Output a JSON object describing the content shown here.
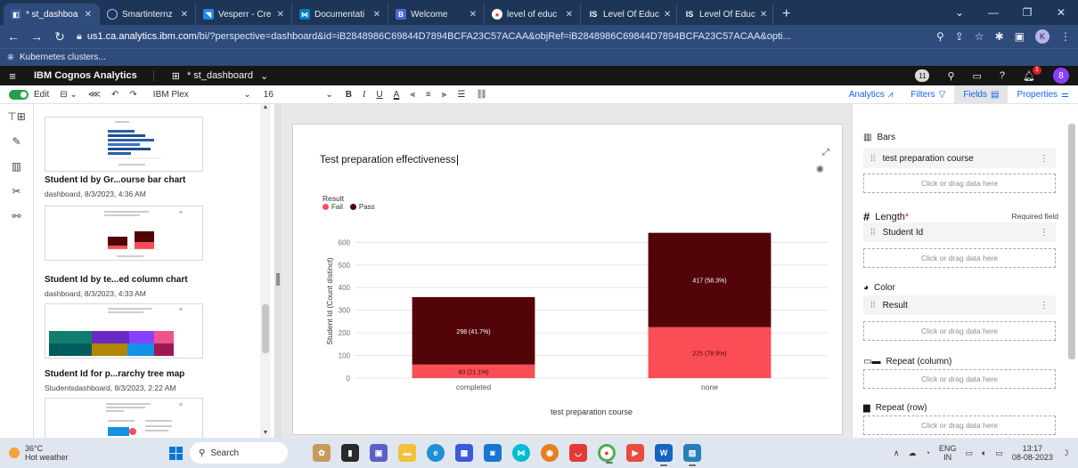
{
  "browser": {
    "tabs": [
      {
        "title": "* st_dashboa",
        "icon": "ibm-icon",
        "active": true
      },
      {
        "title": "Smartinternz",
        "icon": "smartinternz-icon"
      },
      {
        "title": "Vesperr - Cre",
        "icon": "vesperr-icon"
      },
      {
        "title": "Documentati",
        "icon": "vscode-icon"
      },
      {
        "title": "Welcome",
        "icon": "b-icon"
      },
      {
        "title": "level of educ",
        "icon": "chrome-icon"
      },
      {
        "title": "Level Of Educ",
        "icon": "is-icon"
      },
      {
        "title": "Level Of Educ",
        "icon": "is-icon"
      }
    ],
    "url_host": "us1.ca.analytics.ibm.com",
    "url_path": "/bi/?perspective=dashboard&id=iB2848986C69844D7894BCFA23C57ACAA&objRef=iB2848986C69844D7894BCFA23C57ACAA&opti...",
    "profile_initial": "K",
    "bookmark": "Kubernetes clusters..."
  },
  "app": {
    "brand": "IBM Cognos Analytics",
    "dashboard_name": "* st_dashboard",
    "badge_count": "11",
    "notif_count": "1",
    "user_initial": "8"
  },
  "toolbar": {
    "edit_label": "Edit",
    "font": "IBM Plex",
    "size": "16",
    "bold": "B",
    "italic": "I",
    "underline": "U",
    "color": "A",
    "analytics": "Analytics",
    "filters": "Filters",
    "fields": "Fields",
    "properties": "Properties"
  },
  "left_panel": {
    "items": [
      {
        "title": "Student Id by Gr...ourse bar chart",
        "meta": "dashboard, 8/3/2023, 4:36 AM"
      },
      {
        "title": "Student Id by te...ed column chart",
        "meta": "dashboard, 8/3/2023, 4:33 AM"
      },
      {
        "title": "Student Id for p...rarchy tree map",
        "meta": "Studentsdashboard, 8/3/2023, 2:22 AM"
      }
    ]
  },
  "chart_data": {
    "type": "bar",
    "stacked": true,
    "title": "Test preparation effectiveness",
    "legend_title": "Result",
    "legend_position": "top-left",
    "xlabel": "test preparation course",
    "ylabel": "Student Id (Count distinct)",
    "categories": [
      "completed",
      "none"
    ],
    "series": [
      {
        "name": "Fail",
        "color": "#fa4d56",
        "values": [
          60,
          225
        ],
        "labels": [
          "60 (21.1%)",
          "225 (78.9%)"
        ]
      },
      {
        "name": "Pass",
        "color": "#520408",
        "values": [
          298,
          417
        ],
        "labels": [
          "298 (41.7%)",
          "417 (58.3%)"
        ]
      }
    ],
    "yticks": [
      0,
      100,
      200,
      300,
      400,
      500,
      600
    ],
    "ylim": [
      0,
      680
    ],
    "grid": true
  },
  "properties": {
    "bars_label": "Bars",
    "bars_field": "test preparation course",
    "length_label": "Length",
    "required_star": "*",
    "required_text": "Required field",
    "length_field": "Student Id",
    "color_label": "Color",
    "color_field": "Result",
    "repeat_col_label": "Repeat (column)",
    "repeat_row_label": "Repeat (row)",
    "drop_hint": "Click or drag data here"
  },
  "taskbar": {
    "temp": "36°C",
    "weather": "Hot weather",
    "search": "Search",
    "lang1": "ENG",
    "lang2": "IN",
    "time": "13:17",
    "date": "08-08-2023"
  }
}
